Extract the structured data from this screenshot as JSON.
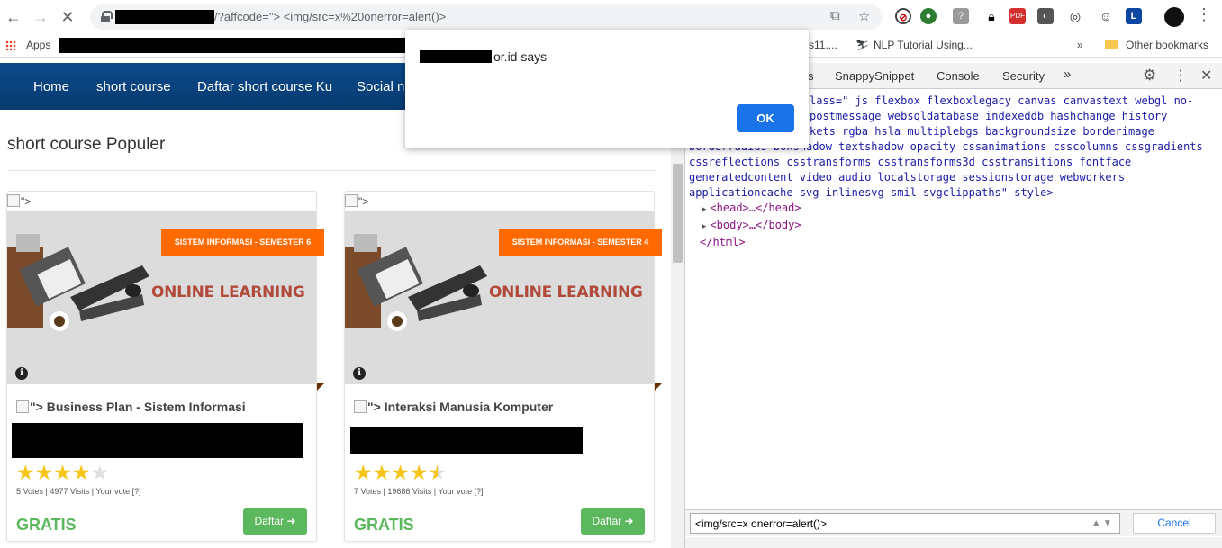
{
  "browser": {
    "url_text": "/?affcode=\"> <img/src=x%20onerror=alert()>",
    "bookmarks": {
      "apps_label": "Apps",
      "partial_item": "s11....",
      "nlp_item": "NLP Tutorial Using...",
      "overflow": "»",
      "other": "Other bookmarks"
    }
  },
  "site": {
    "nav": [
      "Home",
      "short course",
      "Daftar short course Ku",
      "Social ne"
    ],
    "section_title": "short course Populer",
    "broken_img_alt": "\">",
    "banner_text": "ONLINE LEARNING",
    "courses": [
      {
        "tag": "SISTEM INFORMASI - SEMESTER 6",
        "title": "\"> Business Plan - Sistem Informasi",
        "rating": 4,
        "votes_line": "5 Votes | 4977 Visits | Your vote [?]",
        "price": "GRATIS",
        "button": "Daftar ➜"
      },
      {
        "tag": "SISTEM INFORMASI - SEMESTER 4",
        "title": "\"> Interaksi Manusia Komputer",
        "rating": 4.5,
        "votes_line": "7 Votes | 19686 Visits | Your vote [?]",
        "price": "GRATIS",
        "button": "Daftar ➜"
      }
    ]
  },
  "dialog": {
    "message_suffix": "or.id says",
    "ok": "OK"
  },
  "devtools": {
    "tabs": [
      "s",
      "SnappySnippet",
      "Console",
      "Security",
      "»"
    ],
    "code_lines": [
      "lass=\" js flexbox flexboxlegacy canvas canvastext webgl no-",
      "postmessage websqldatabase indexeddb hashchange history",
      "kets rgba hsla multiplebgs backgroundsize borderimage",
      "borderradius boxshadow textshadow opacity cssanimations csscolumns cssgradients",
      "cssreflections csstransforms csstransforms3d csstransitions fontface",
      "generatedcontent video audio localstorage sessionstorage webworkers",
      "applicationcache svg inlinesvg smil svgclippaths\" style>"
    ],
    "head_node": "<head>…</head>",
    "body_node": "<body>…</body>",
    "html_close": "</html>",
    "search_value": "<img/src=x onerror=alert()>",
    "cancel": "Cancel"
  }
}
